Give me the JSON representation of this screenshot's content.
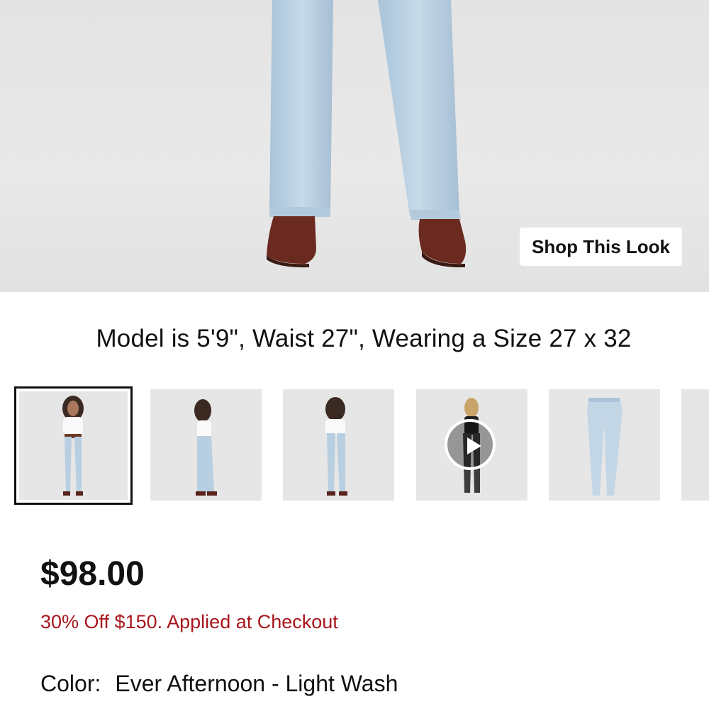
{
  "hero": {
    "shop_look_label": "Shop This Look"
  },
  "model_info": "Model is 5'9\", Waist 27\", Wearing a Size 27 x 32",
  "thumbnails": [
    {
      "name": "front view",
      "selected": true
    },
    {
      "name": "side view",
      "selected": false
    },
    {
      "name": "back view",
      "selected": false
    },
    {
      "name": "video",
      "selected": false,
      "has_play_icon": true
    },
    {
      "name": "flat lay",
      "selected": false
    },
    {
      "name": "more",
      "selected": false
    }
  ],
  "product": {
    "price": "$98.00",
    "promo": "30% Off $150. Applied at Checkout",
    "color_label": "Color:",
    "color_value": "Ever Afternoon - Light Wash"
  },
  "colors": {
    "promo_red": "#a8161c",
    "denim_light": "#b9d0e2",
    "boot_brown": "#6b2a1f"
  }
}
